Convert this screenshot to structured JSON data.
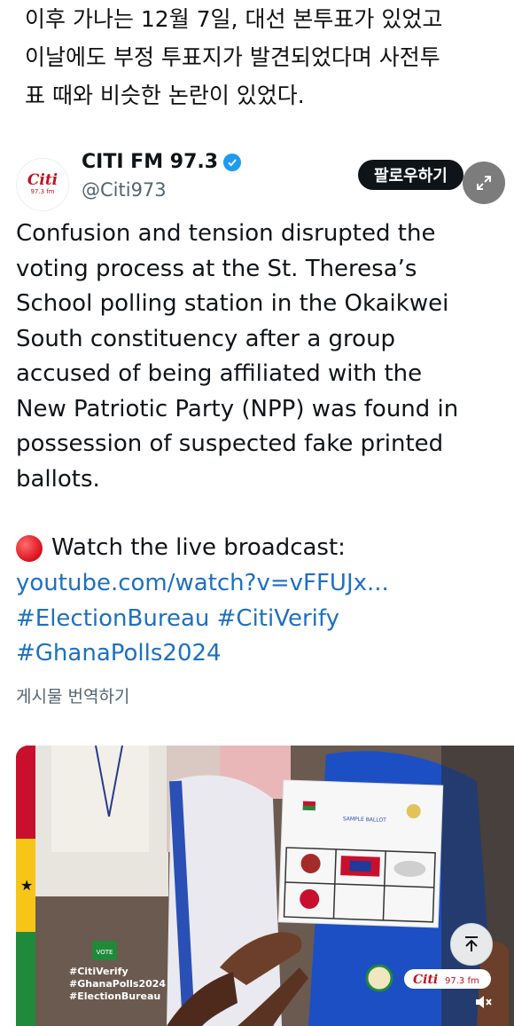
{
  "article": {
    "lines": [
      "이후 가나는 12월 7일, 대선 본투표가 있었고",
      "이날에도 부정 투표지가 발견되었다며 사전투",
      "표 때와 비슷한 논란이 있었다."
    ]
  },
  "tweet": {
    "avatar": {
      "top": "Citi",
      "bottom": "97.3 fm"
    },
    "display_name": "CITI FM 97.3",
    "handle": "@Citi973",
    "follow_label": "팔로우하기",
    "body_lines": [
      "Confusion and tension disrupted the",
      "voting process at the St. Theresa’s",
      "School polling station in the Okaikwei",
      "South constituency after a group",
      "accused of being affiliated with the",
      "New Patriotic Party (NPP) was found in",
      "possession of suspected fake printed",
      "ballots."
    ],
    "live_text": "Watch the live broadcast:",
    "links": [
      "youtube.com/watch?v=vFFUJx...",
      "#ElectionBureau #CitiVerify",
      "#GhanaPolls2024"
    ],
    "translate_label": "게시물 번역하기",
    "media": {
      "ballot_title": "SAMPLE BALLOT",
      "overlay_tags": [
        "#CitiVerify",
        "#GhanaPolls2024",
        "#ElectionBureau"
      ],
      "vote_label": "VOTE",
      "logo_text": "Citi",
      "logo_fm": "97.3 fm"
    }
  },
  "colors": {
    "link": "#1d70c2",
    "verified": "#1d9bf0",
    "brand_red": "#c1121f",
    "secondary_text": "#536471"
  }
}
